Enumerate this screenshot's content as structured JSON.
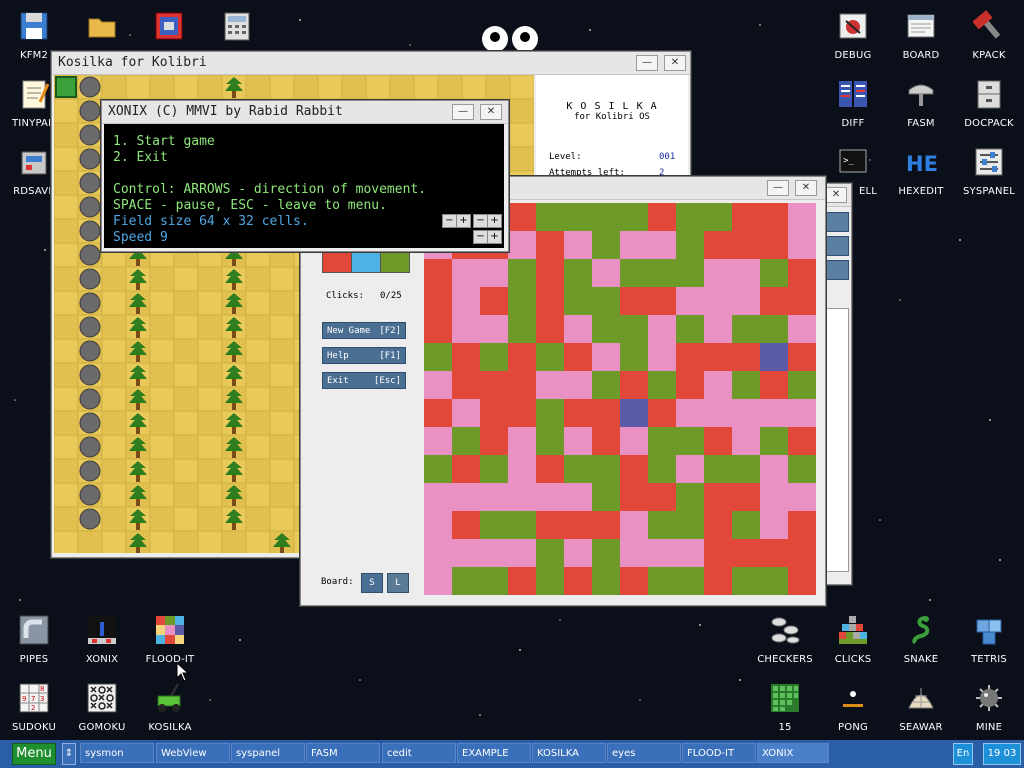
{
  "desktop": {
    "icons_left": [
      {
        "label": "KFM2",
        "icon": "floppy-icon"
      },
      {
        "label": "TINYPAD",
        "icon": "notepad-icon"
      },
      {
        "label": "RDSAVE",
        "icon": "drive-icon"
      },
      {
        "label": "PIPES",
        "icon": "pipes-icon"
      },
      {
        "label": "XONIX",
        "icon": "xonix-icon"
      },
      {
        "label": "FLOOD-IT",
        "icon": "flood-it-icon"
      },
      {
        "label": "SUDOKU",
        "icon": "sudoku-icon"
      },
      {
        "label": "GOMOKU",
        "icon": "gomoku-icon"
      },
      {
        "label": "KOSILKA",
        "icon": "lawnmower-icon"
      }
    ],
    "icons_right": [
      {
        "label": "DEBUG",
        "icon": "debug-icon"
      },
      {
        "label": "BOARD",
        "icon": "board-icon"
      },
      {
        "label": "KPACK",
        "icon": "kpack-icon"
      },
      {
        "label": "DIFF",
        "icon": "diff-icon"
      },
      {
        "label": "FASM",
        "icon": "fasm-icon"
      },
      {
        "label": "DOCPACK",
        "icon": "docpack-icon"
      },
      {
        "label": "ELL",
        "icon": "shell-icon"
      },
      {
        "label": "HEXEDIT",
        "icon": "hexedit-icon"
      },
      {
        "label": "SYSPANEL",
        "icon": "syspanel-icon"
      },
      {
        "label": "CHECKERS",
        "icon": "checkers-icon"
      },
      {
        "label": "CLICKS",
        "icon": "clicks-icon"
      },
      {
        "label": "SNAKE",
        "icon": "snake-icon"
      },
      {
        "label": "TETRIS",
        "icon": "tetris-icon"
      },
      {
        "label": "15",
        "icon": "fifteen-icon"
      },
      {
        "label": "PONG",
        "icon": "pong-icon"
      },
      {
        "label": "SEAWAR",
        "icon": "seawar-icon"
      },
      {
        "label": "MINE",
        "icon": "mine-icon"
      }
    ]
  },
  "kosilka": {
    "title": "Kosilka for Kolibri",
    "logo_title": "K O S I L K A",
    "logo_sub": "for Kolibri OS",
    "level_label": "Level:",
    "level_value": "001",
    "attempts_label": "Attempts left:",
    "attempts_value": "2"
  },
  "xonix": {
    "title": "XONIX (C) MMVI by Rabid Rabbit",
    "lines": [
      "1. Start game",
      "2. Exit",
      "",
      "Control: ARROWS - direction of movement.",
      "SPACE - pause, ESC - leave to menu.",
      "Field size 64 x 32 cells.",
      "Speed 9"
    ]
  },
  "flood": {
    "clicks_label": "Clicks:",
    "clicks_value": "0/25",
    "new_game": "New Game",
    "new_game_key": "[F2]",
    "help": "Help",
    "help_key": "[F1]",
    "exit": "Exit",
    "exit_key": "[Esc]",
    "board_label": "Board:",
    "board_s": "S",
    "board_l": "L",
    "colors": [
      "#e2483a",
      "#4fb2e4",
      "#6e9a2a",
      "#f5d47c",
      "#e991c2",
      "#5b5aa6"
    ]
  },
  "taskbar": {
    "menu": "Menu",
    "items": [
      "sysmon",
      "WebView",
      "syspanel",
      "FASM",
      "cedit",
      "EXAMPLE",
      "KOSILKA",
      "eyes",
      "FLOOD-IT",
      "XONIX"
    ],
    "lang": "En",
    "time": "19 03"
  }
}
